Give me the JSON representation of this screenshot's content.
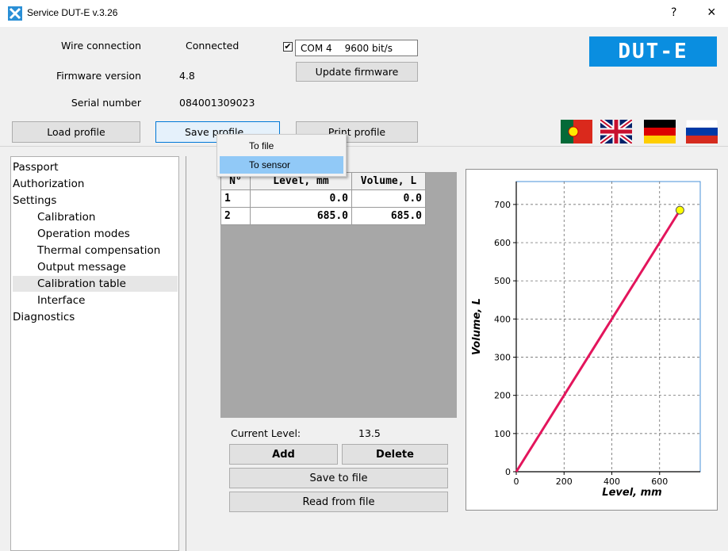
{
  "window": {
    "title": "Service DUT-E v.3.26",
    "help": "?",
    "close": "×"
  },
  "info": {
    "wire_label": "Wire connection",
    "wire_value": "Connected",
    "firmware_label": "Firmware version",
    "firmware_value": "4.8",
    "serial_label": "Serial number",
    "serial_value": "084001309023"
  },
  "port": {
    "checked": true,
    "check_mark": "✔",
    "com": "COM 4",
    "speed": "9600 bit/s"
  },
  "buttons": {
    "update_firmware": "Update firmware",
    "load_profile": "Load profile",
    "save_profile": "Save profile",
    "print_profile": "Print profile"
  },
  "logo": "DUT-E",
  "flags": [
    "portugal",
    "united-kingdom",
    "germany",
    "russia"
  ],
  "menu": {
    "items": [
      "To file",
      "To sensor"
    ],
    "highlighted": "To sensor"
  },
  "tree": {
    "items": [
      "Passport",
      "Authorization",
      "Settings"
    ],
    "settings_children": [
      "Calibration",
      "Operation modes",
      "Thermal compensation",
      "Output message",
      "Calibration table",
      "Interface"
    ],
    "selected": "Calibration table",
    "diagnostics": "Diagnostics"
  },
  "table": {
    "headers": [
      "N°",
      "Level, mm",
      "Volume, L"
    ],
    "rows": [
      {
        "n": "1",
        "level": "0.0",
        "volume": "0.0"
      },
      {
        "n": "2",
        "level": "685.0",
        "volume": "685.0"
      }
    ]
  },
  "current_level": {
    "label": "Current Level:",
    "value": "13.5"
  },
  "actions": {
    "add": "Add",
    "delete": "Delete",
    "save_to_file": "Save to file",
    "read_from_file": "Read from file"
  },
  "chart_data": {
    "type": "line",
    "xlabel": "Level, mm",
    "ylabel": "Volume, L",
    "xlim": [
      0,
      770
    ],
    "ylim": [
      0,
      760
    ],
    "xticks": [
      0,
      200,
      400,
      600
    ],
    "yticks": [
      0,
      100,
      200,
      300,
      400,
      500,
      600,
      700
    ],
    "grid": true,
    "series": [
      {
        "x": [
          0,
          685
        ],
        "y": [
          0,
          685
        ],
        "color": "#e3155c"
      }
    ],
    "marker": {
      "x": 685,
      "y": 685,
      "color": "#ffff00"
    }
  }
}
